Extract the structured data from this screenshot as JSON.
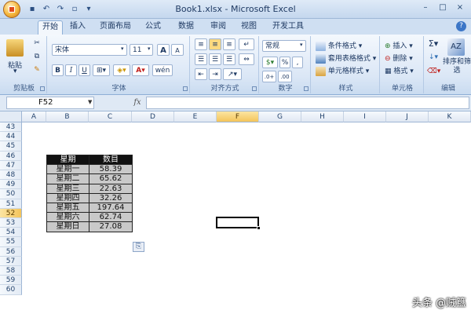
{
  "title": "Book1.xlsx - Microsoft Excel",
  "qat": {
    "save_icon": "floppy-disk",
    "undo_icon": "undo",
    "redo_icon": "redo",
    "print_preview_icon": "print-preview"
  },
  "tabs": [
    "开始",
    "插入",
    "页面布局",
    "公式",
    "数据",
    "审阅",
    "视图",
    "开发工具"
  ],
  "ribbon": {
    "clipboard": {
      "paste_label": "粘贴",
      "group_label": "剪贴板"
    },
    "font": {
      "font_name": "宋体",
      "font_size": "11",
      "group_label": "字体",
      "bold": "B",
      "italic": "I",
      "underline": "U",
      "grow": "A",
      "shrink": "A",
      "phonetic": "wén"
    },
    "alignment": {
      "group_label": "对齐方式"
    },
    "number": {
      "format": "常规",
      "percent": "%",
      "comma": ",",
      "group_label": "数字"
    },
    "styles": {
      "conditional_format": "条件格式",
      "table_format": "套用表格格式",
      "cell_styles": "单元格样式",
      "group_label": "样式"
    },
    "cells": {
      "insert": "插入",
      "delete": "删除",
      "format": "格式",
      "group_label": "单元格"
    },
    "editing": {
      "sort_filter": "排序和筛选",
      "group_label": "编辑"
    }
  },
  "formula_bar": {
    "name_box": "F52",
    "fx": "fx",
    "formula": ""
  },
  "columns": [
    "A",
    "B",
    "C",
    "D",
    "E",
    "F",
    "G",
    "H",
    "I",
    "J",
    "K"
  ],
  "selected_column": "F",
  "rows": [
    "43",
    "44",
    "45",
    "46",
    "47",
    "48",
    "49",
    "50",
    "51",
    "52",
    "53",
    "54",
    "55",
    "56",
    "57",
    "58",
    "59",
    "60"
  ],
  "selected_row": "52",
  "table": {
    "headers": [
      "星期",
      "数目"
    ],
    "rows": [
      [
        "星期一",
        "58.39"
      ],
      [
        "星期二",
        "65.62"
      ],
      [
        "星期三",
        "22.63"
      ],
      [
        "星期四",
        "32.26"
      ],
      [
        "星期五",
        "197.64"
      ],
      [
        "星期六",
        "62.74"
      ],
      [
        "星期日",
        "27.08"
      ]
    ]
  },
  "watermark": "头条 @贼簋"
}
